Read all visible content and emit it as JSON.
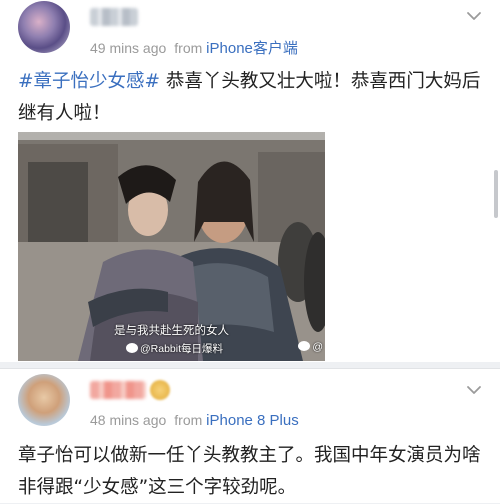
{
  "post1": {
    "time": "49 mins ago",
    "from_label": "from",
    "source": "iPhone客户端",
    "hashtag": "#章子怡少女感#",
    "text": " 恭喜丫头教又壮大啦！恭喜西门大妈后继有人啦！",
    "image": {
      "caption": "是与我共赴生死的女人",
      "watermark": "@Rabbit每日爆料",
      "watermark2": "@"
    }
  },
  "post2": {
    "time": "48 mins ago",
    "from_label": "from",
    "source": "iPhone 8 Plus",
    "text": "章子怡可以做新一任丫头教教主了。我国中年女演员为啥非得跟“少女感”这三个字较劲呢。"
  },
  "icons": {
    "menu": "chevron-down-icon",
    "weibo": "weibo-icon"
  },
  "colors": {
    "link": "#3a6fbf",
    "meta": "#9a9a9a",
    "background": "#eef0f3"
  }
}
